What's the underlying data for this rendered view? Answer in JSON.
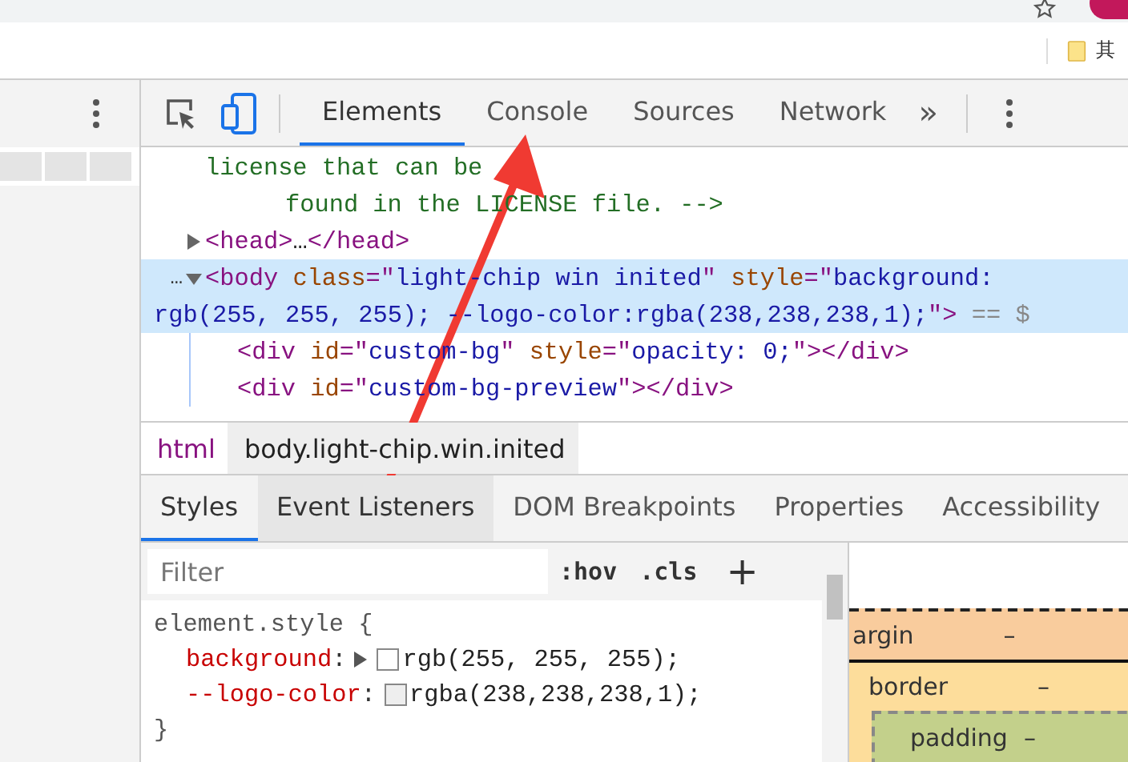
{
  "browser": {
    "bookmark": "其"
  },
  "toolbar": {
    "tabs": [
      {
        "label": "Elements",
        "selected": true
      },
      {
        "label": "Console",
        "selected": false
      },
      {
        "label": "Sources",
        "selected": false
      },
      {
        "label": "Network",
        "selected": false
      }
    ],
    "overflow": "»"
  },
  "elements": {
    "nodes": [
      {
        "kind": "comment",
        "selected": false,
        "lines": [
          [
            {
              "kind": "comment",
              "t": "license that can be"
            }
          ],
          [
            {
              "kind": "comment",
              "t": "found in the LICENSE file. -->"
            }
          ]
        ]
      },
      {
        "kind": "element",
        "selected": false,
        "expanded": false,
        "lines": [
          [
            {
              "kind": "tag",
              "t": "<head>"
            },
            {
              "kind": "text",
              "t": "…"
            },
            {
              "kind": "tag",
              "t": "</head>"
            }
          ]
        ]
      },
      {
        "kind": "element",
        "selected": true,
        "expanded": true,
        "dots": "…",
        "lines": [
          [
            {
              "kind": "tag",
              "t": "<body "
            },
            {
              "kind": "attr",
              "t": "class"
            },
            {
              "kind": "tag",
              "t": "=\""
            },
            {
              "kind": "val",
              "t": "light-chip win inited"
            },
            {
              "kind": "tag",
              "t": "\" "
            },
            {
              "kind": "attr",
              "t": "style"
            },
            {
              "kind": "tag",
              "t": "=\""
            },
            {
              "kind": "val",
              "t": "background:"
            }
          ],
          [
            {
              "kind": "val",
              "t": "rgb(255, 255, 255); --logo-color:rgba(238,238,238,1);"
            },
            {
              "kind": "tag",
              "t": "\">"
            },
            {
              "kind": "grey",
              "t": " == $"
            }
          ]
        ],
        "children": [
          {
            "kind": "element",
            "selected": false,
            "lines": [
              [
                {
                  "kind": "tag",
                  "t": "<div "
                },
                {
                  "kind": "attr",
                  "t": "id"
                },
                {
                  "kind": "tag",
                  "t": "=\""
                },
                {
                  "kind": "val",
                  "t": "custom-bg"
                },
                {
                  "kind": "tag",
                  "t": "\" "
                },
                {
                  "kind": "attr",
                  "t": "style"
                },
                {
                  "kind": "tag",
                  "t": "=\""
                },
                {
                  "kind": "val",
                  "t": "opacity: 0;"
                },
                {
                  "kind": "tag",
                  "t": "\"></div>"
                }
              ]
            ]
          },
          {
            "kind": "element",
            "selected": false,
            "lines": [
              [
                {
                  "kind": "tag",
                  "t": "<div "
                },
                {
                  "kind": "attr",
                  "t": "id"
                },
                {
                  "kind": "tag",
                  "t": "=\""
                },
                {
                  "kind": "val",
                  "t": "custom-bg-preview"
                },
                {
                  "kind": "tag",
                  "t": "\"></div>"
                }
              ]
            ]
          }
        ]
      }
    ]
  },
  "breadcrumbs": [
    {
      "label": "html",
      "selected": false,
      "kind": "tag"
    },
    {
      "label": "body.light-chip.win.inited",
      "selected": true,
      "kind": "selector"
    }
  ],
  "sidebar_tabs": [
    {
      "label": "Styles",
      "selected": true,
      "hovered": false
    },
    {
      "label": "Event Listeners",
      "selected": false,
      "hovered": true
    },
    {
      "label": "DOM Breakpoints",
      "selected": false,
      "hovered": false
    },
    {
      "label": "Properties",
      "selected": false,
      "hovered": false
    },
    {
      "label": "Accessibility",
      "selected": false,
      "hovered": false
    }
  ],
  "styles": {
    "filter": {
      "placeholder": "Filter"
    },
    "hov": ":hov",
    "cls": ".cls",
    "add": "+",
    "rule": {
      "selector": "element.style {",
      "close": "}",
      "declarations": [
        {
          "property": "background",
          "separator": ":",
          "expandable": true,
          "color": "#ffffff",
          "value": "rgb(255, 255, 255);"
        },
        {
          "property": "--logo-color",
          "separator": ":",
          "expandable": false,
          "color": "#eeeeee",
          "value": "rgba(238,238,238,1);"
        }
      ]
    }
  },
  "box_model": {
    "margin": {
      "label": "argin",
      "value": "–"
    },
    "border": {
      "label": "border",
      "value": "–"
    },
    "padding": {
      "label": "padding",
      "value": "–"
    }
  }
}
